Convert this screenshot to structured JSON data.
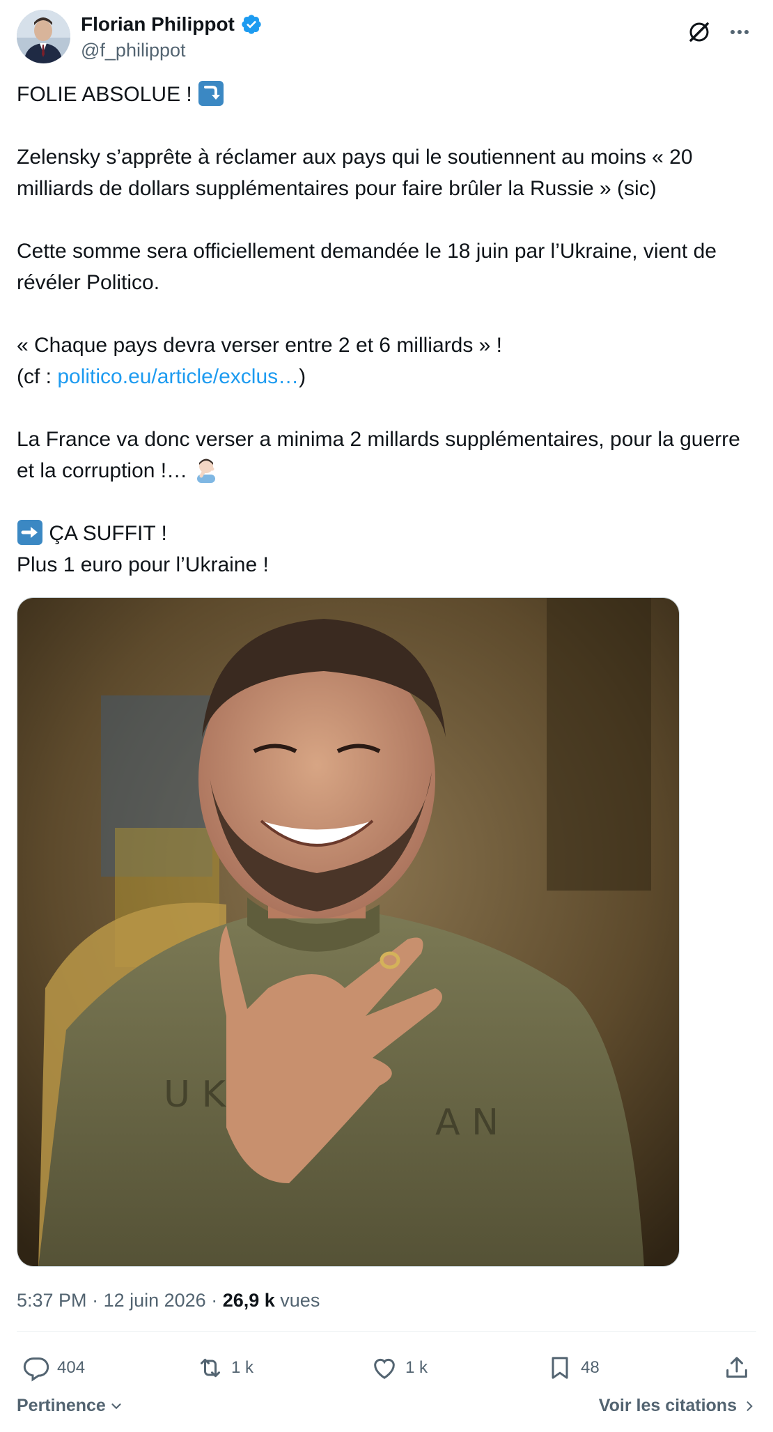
{
  "author": {
    "display_name": "Florian Philippot",
    "handle": "@f_philippot",
    "avatar_icon": "avatar-photo",
    "verified_icon": "verified-badge-icon"
  },
  "header_actions": {
    "grok_icon": "grok-icon",
    "more_icon": "more-options-icon"
  },
  "tweet": {
    "line1": "FOLIE ABSOLUE ! ",
    "line1_emoji": "arrow-down-right-emoji",
    "para2": "Zelensky s’apprête à réclamer aux pays qui le soutiennent au moins « 20 milliards de dollars supplémentaires pour faire brûler la Russie » (sic)",
    "para3": "Cette somme sera officiellement demandée le 18 juin par l’Ukraine, vient de révéler Politico.",
    "para4_line1": "« Chaque pays devra verser entre 2 et 6 milliards » !",
    "para4_prefix": "(cf : ",
    "para4_link": "politico.eu/article/exclus…",
    "para4_suffix": ")",
    "para5": "La France va donc verser a minima 2 millards supplémentaires, pour la guerre et la corruption !… ",
    "para5_emoji": "facepalm-emoji",
    "para6_line1": " ÇA SUFFIT !",
    "para6_emoji": "arrow-right-emoji",
    "para6_line2": "Plus 1 euro pour l’Ukraine !"
  },
  "media": {
    "type": "photo",
    "subject": "man-smiling-hand-on-chest"
  },
  "meta": {
    "time": "5:37 PM",
    "separator1": " · ",
    "date": "12 juin 2026",
    "separator2": " · ",
    "views_count": "26,9 k",
    "views_label": " vues"
  },
  "actions": {
    "reply": {
      "icon": "reply-icon",
      "count": "404"
    },
    "repost": {
      "icon": "repost-icon",
      "count": "1 k"
    },
    "like": {
      "icon": "heart-icon",
      "count": "1 k"
    },
    "bookmark": {
      "icon": "bookmark-icon",
      "count": "48"
    },
    "share": {
      "icon": "share-icon"
    }
  },
  "footer": {
    "sort_label": "Pertinence",
    "quotes_label": "Voir les citations"
  },
  "colors": {
    "link": "#1d9bf0",
    "muted": "#536471",
    "text": "#0f1419",
    "verified": "#1d9bf0"
  }
}
